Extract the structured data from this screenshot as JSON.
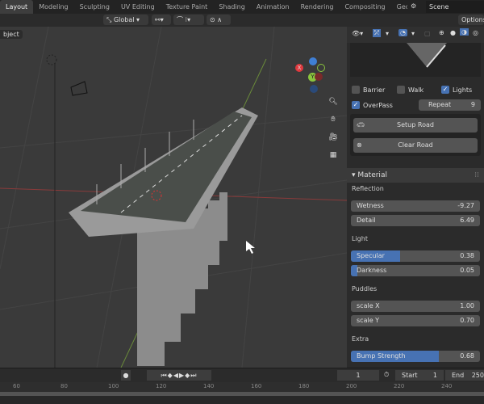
{
  "workspace_tabs": [
    "Layout",
    "Modeling",
    "Sculpting",
    "UV Editing",
    "Texture Paint",
    "Shading",
    "Animation",
    "Rendering",
    "Compositing",
    "Geometry Nod"
  ],
  "active_tab": "Layout",
  "scene": "Scene",
  "toolbar": {
    "orientation": "Global",
    "options": "Options"
  },
  "viewport": {
    "mode_label": "bject",
    "gizmo": {
      "x": "X",
      "y": "Y",
      "z": "Z"
    }
  },
  "road_panel": {
    "checkboxes": [
      {
        "label": "Barrier",
        "checked": false
      },
      {
        "label": "Walk",
        "checked": false
      },
      {
        "label": "Lights",
        "checked": true
      },
      {
        "label": "OverPass",
        "checked": true
      }
    ],
    "repeat": {
      "label": "Repeat",
      "value": "9"
    },
    "setup_button": "Setup Road",
    "clear_button": "Clear Road"
  },
  "material": {
    "title": "Material",
    "groups": [
      {
        "label": "Reflection",
        "fields": [
          {
            "name": "Wetness",
            "value": "-9.27",
            "fill": 0
          },
          {
            "name": "Detail",
            "value": "6.49",
            "fill": 0
          }
        ]
      },
      {
        "label": "Light",
        "fields": [
          {
            "name": "Specular",
            "value": "0.38",
            "fill": 0.38
          },
          {
            "name": "Darkness",
            "value": "0.05",
            "fill": 0.05
          }
        ]
      },
      {
        "label": "Puddles",
        "fields": [
          {
            "name": "scale X",
            "value": "1.00",
            "fill": 0
          },
          {
            "name": "scale Y",
            "value": "0.70",
            "fill": 0
          }
        ]
      },
      {
        "label": "Extra",
        "fields": [
          {
            "name": "Bump Strength",
            "value": "0.68",
            "fill": 0.68
          }
        ]
      }
    ]
  },
  "timeline": {
    "current_frame": "1",
    "start_label": "Start",
    "start": "1",
    "end_label": "End",
    "end": "250",
    "ticks": [
      "60",
      "80",
      "100",
      "120",
      "140",
      "160",
      "180",
      "200",
      "220",
      "240"
    ]
  },
  "colors": {
    "accent": "#4772b3",
    "x_axis": "#e0393e",
    "y_axis": "#8ac43e",
    "z_axis": "#3f7fd5"
  }
}
